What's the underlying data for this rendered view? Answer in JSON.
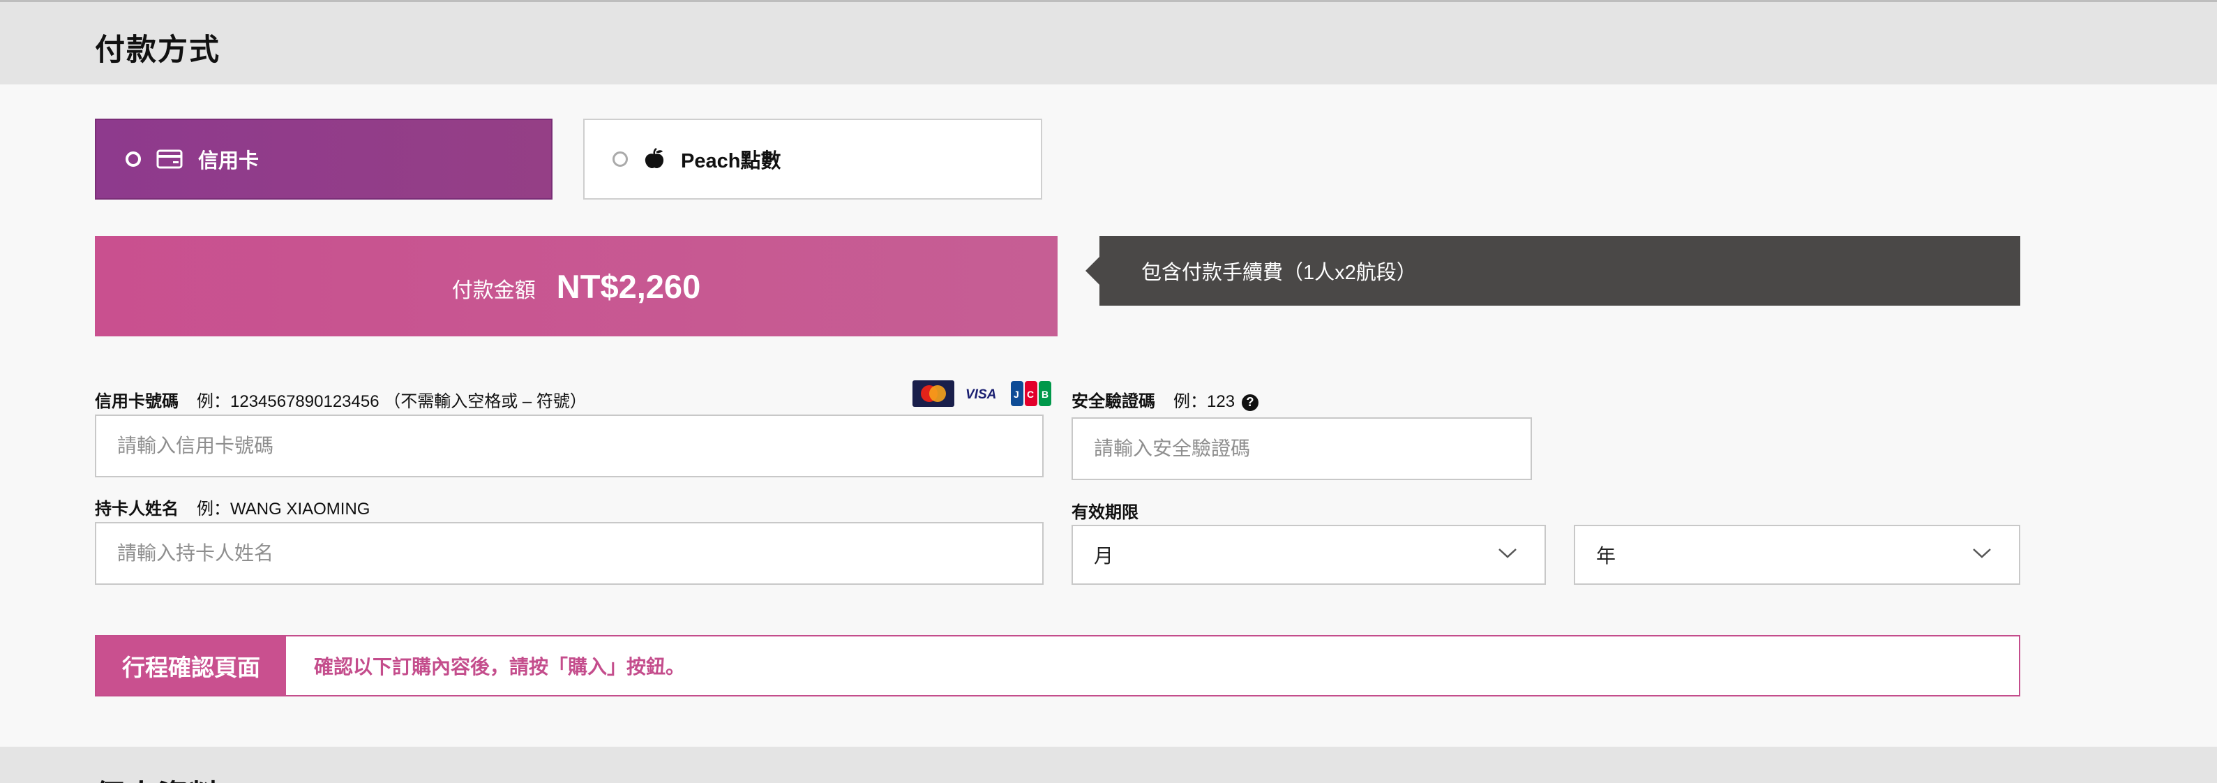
{
  "sections": {
    "payment_title": "付款方式",
    "personal_title": "個人資料"
  },
  "payment_methods": [
    {
      "label": "信用卡",
      "icon": "credit-card-icon",
      "selected": true
    },
    {
      "label": "Peach點數",
      "icon": "peach-icon",
      "selected": false
    }
  ],
  "amount": {
    "label": "付款金額",
    "value": "NT$2,260"
  },
  "fee_note": "包含付款手續費（1人x2航段）",
  "card_number": {
    "label": "信用卡號碼",
    "example": "例：1234567890123456 （不需輸入空格或 – 符號）",
    "placeholder": "請輸入信用卡號碼"
  },
  "card_brands": [
    "mastercard-icon",
    "visa-icon",
    "jcb-icon"
  ],
  "security_code": {
    "label": "安全驗證碼",
    "example": "例：123",
    "placeholder": "請輸入安全驗證碼"
  },
  "holder_name": {
    "label": "持卡人姓名",
    "example": "例：WANG XIAOMING",
    "placeholder": "請輸入持卡人姓名"
  },
  "expiry": {
    "label": "有效期限",
    "month": "月",
    "year": "年"
  },
  "confirm": {
    "tag": "行程確認頁面",
    "text": "確認以下訂購內容後，請按「購入」按鈕。"
  },
  "colors": {
    "purple": "#8e3a8d",
    "pink": "#c9508f",
    "dark_note": "#4a4847"
  }
}
